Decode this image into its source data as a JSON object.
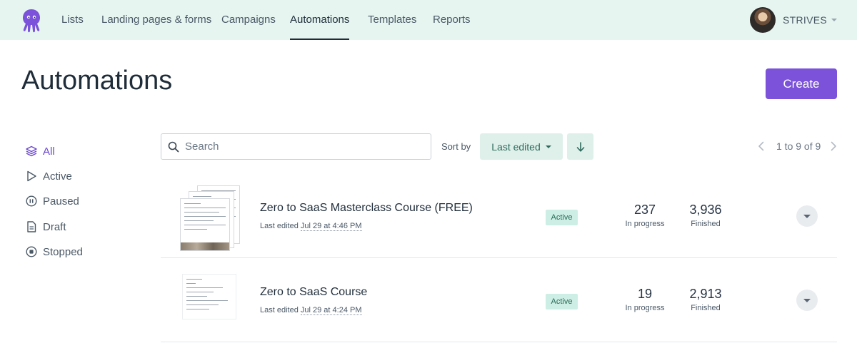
{
  "nav": {
    "items": [
      {
        "label": "Lists"
      },
      {
        "label": "Landing pages & forms"
      },
      {
        "label": "Campaigns"
      },
      {
        "label": "Automations",
        "active": true
      },
      {
        "label": "Templates"
      },
      {
        "label": "Reports"
      }
    ],
    "account_name": "STRIVES"
  },
  "header": {
    "title": "Automations",
    "create_label": "Create"
  },
  "filters": [
    {
      "label": "All",
      "icon": "layers-icon",
      "selected": true
    },
    {
      "label": "Active",
      "icon": "play-icon"
    },
    {
      "label": "Paused",
      "icon": "pause-circle-icon"
    },
    {
      "label": "Draft",
      "icon": "document-icon"
    },
    {
      "label": "Stopped",
      "icon": "stop-circle-icon"
    }
  ],
  "toolbar": {
    "search_placeholder": "Search",
    "sort_by_label": "Sort by",
    "sort_value": "Last edited",
    "sort_direction": "descending",
    "pagination": "1 to 9 of 9"
  },
  "automations": [
    {
      "title": "Zero to SaaS Masterclass Course (FREE)",
      "last_edited_prefix": "Last edited",
      "last_edited": "Jul 29 at 4:46 PM",
      "status": "Active",
      "in_progress": "237",
      "in_progress_label": "In progress",
      "finished": "3,936",
      "finished_label": "Finished"
    },
    {
      "title": "Zero to SaaS Course",
      "last_edited_prefix": "Last edited",
      "last_edited": "Jul 29 at 4:24 PM",
      "status": "Active",
      "in_progress": "19",
      "in_progress_label": "In progress",
      "finished": "2,913",
      "finished_label": "Finished"
    }
  ],
  "colors": {
    "topbar_bg": "#e6f5f0",
    "accent": "#7b52d9",
    "selected_filter": "#6a48c8",
    "status_active_bg": "#cdeee4"
  }
}
